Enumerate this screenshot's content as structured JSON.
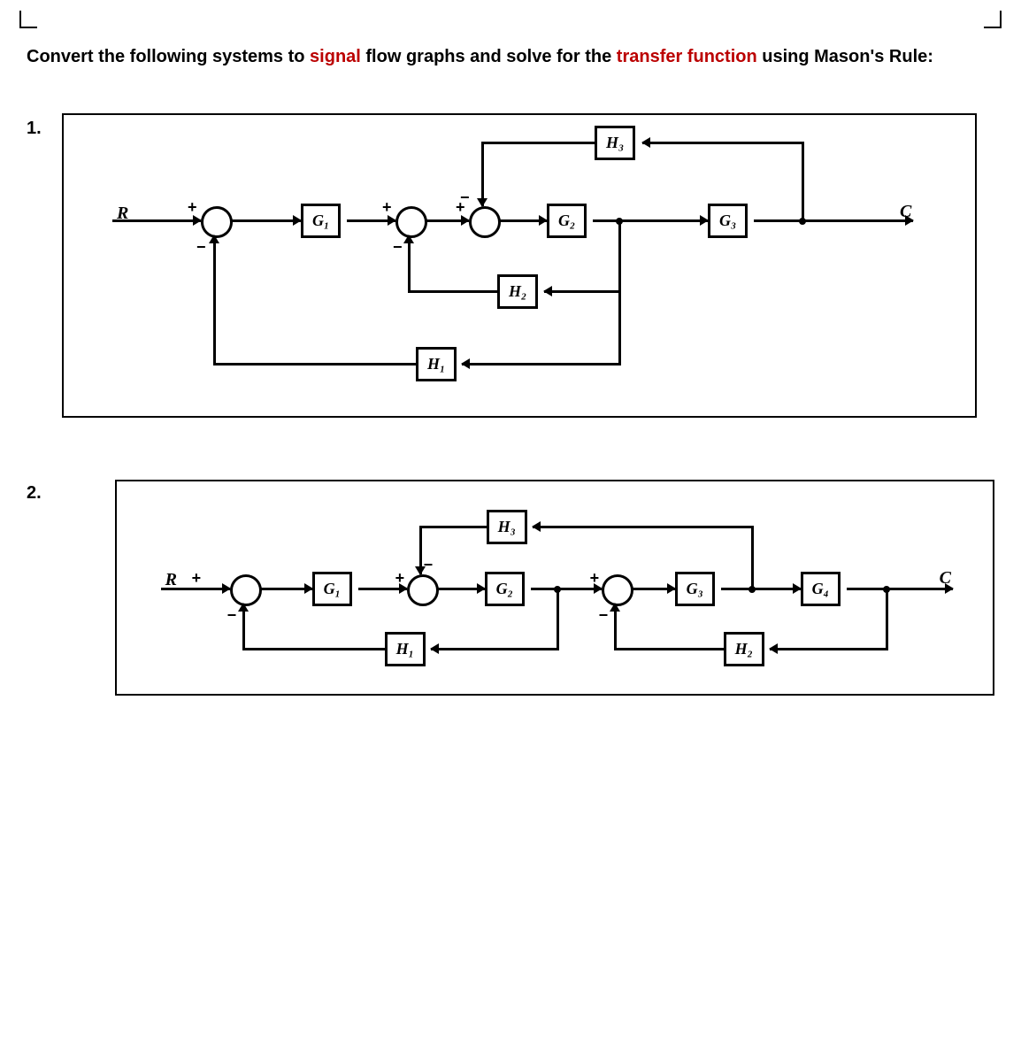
{
  "instruction": {
    "pre": "Convert the following systems to ",
    "signal": "signal",
    "mid": " flow graphs and solve for the ",
    "transfer": "transfer function",
    "post": " using Mason's Rule:"
  },
  "problems": [
    {
      "number": "1.",
      "input_label": "R",
      "output_label": "C",
      "blocks": {
        "G1": "G₁",
        "G2": "G₂",
        "G3": "G₃",
        "H1": "H₁",
        "H2": "H₂",
        "H3": "H₃"
      },
      "signs": {
        "s1_top": "+",
        "s1_bot": "−",
        "s2_top": "+",
        "s2_bot": "−",
        "s3_top": "+",
        "s3_ul": "−"
      }
    },
    {
      "number": "2.",
      "input_label": "R",
      "output_label": "C",
      "blocks": {
        "G1": "G₁",
        "G2": "G₂",
        "G3": "G₃",
        "G4": "G₄",
        "H1": "H₁",
        "H2": "H₂",
        "H3": "H₃"
      },
      "signs": {
        "s1_top": "+",
        "s1_bot": "−",
        "s2_top": "+",
        "s2_ul": "−",
        "s3_top": "+",
        "s3_bot": "−"
      }
    }
  ]
}
